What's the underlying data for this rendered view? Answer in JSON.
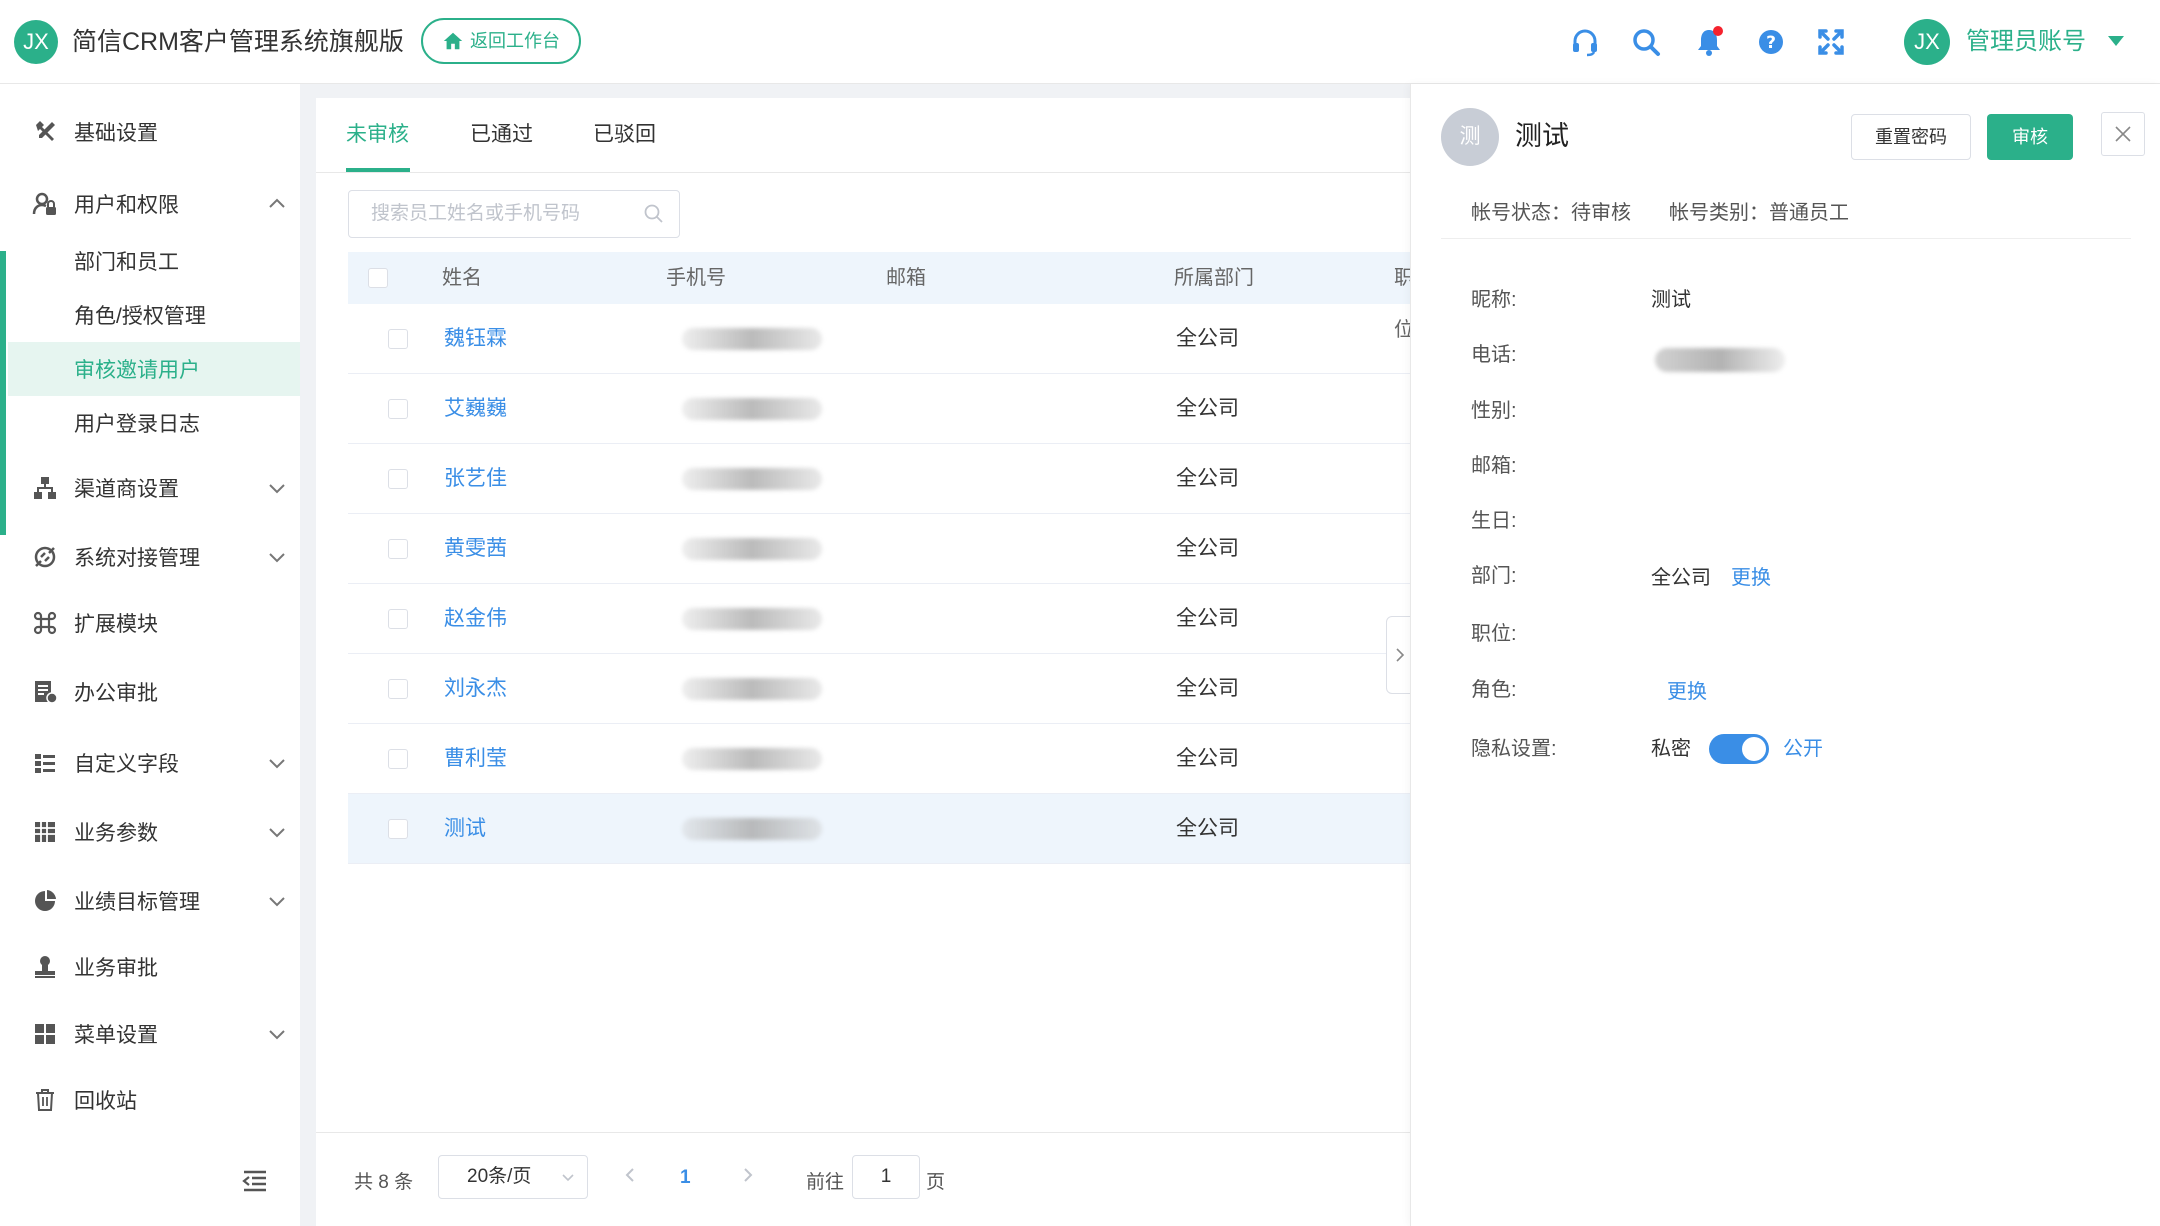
{
  "header": {
    "logo_text": "JX",
    "app_title": "简信CRM客户管理系统旗舰版",
    "back_button": "返回工作台",
    "avatar_text": "JX",
    "admin_name": "管理员账号",
    "accent_color": "#2bb08a"
  },
  "sidebar": {
    "items": [
      {
        "label": "基础设置",
        "icon": "wrench-icon"
      },
      {
        "label": "用户和权限",
        "icon": "user-lock-icon"
      },
      {
        "label": "部门和员工"
      },
      {
        "label": "角色/授权管理"
      },
      {
        "label": "审核邀请用户"
      },
      {
        "label": "用户登录日志"
      },
      {
        "label": "渠道商设置",
        "icon": "network-icon"
      },
      {
        "label": "系统对接管理",
        "icon": "plug-icon"
      },
      {
        "label": "扩展模块",
        "icon": "command-icon"
      },
      {
        "label": "办公审批",
        "icon": "approval-doc-icon"
      },
      {
        "label": "自定义字段",
        "icon": "list-icon"
      },
      {
        "label": "业务参数",
        "icon": "grid-icon"
      },
      {
        "label": "业绩目标管理",
        "icon": "target-icon"
      },
      {
        "label": "业务审批",
        "icon": "stamp-icon"
      },
      {
        "label": "菜单设置",
        "icon": "menu-grid-icon"
      },
      {
        "label": "回收站",
        "icon": "trash-icon"
      }
    ]
  },
  "main": {
    "tabs": [
      "未审核",
      "已通过",
      "已驳回"
    ],
    "search_placeholder": "搜索员工姓名或手机号码",
    "columns": [
      "姓名",
      "手机号",
      "邮箱",
      "所属部门",
      "职位"
    ],
    "rows": [
      {
        "name": "魏钰霖",
        "dept": "全公司"
      },
      {
        "name": "艾巍巍",
        "dept": "全公司"
      },
      {
        "name": "张艺佳",
        "dept": "全公司"
      },
      {
        "name": "黄雯茜",
        "dept": "全公司"
      },
      {
        "name": "赵金伟",
        "dept": "全公司"
      },
      {
        "name": "刘永杰",
        "dept": "全公司"
      },
      {
        "name": "曹利莹",
        "dept": "全公司"
      },
      {
        "name": "测试",
        "dept": "全公司"
      }
    ],
    "pager": {
      "total": "共 8 条",
      "page_size": "20条/页",
      "current_page": "1",
      "goto_label": "前往",
      "goto_value": "1",
      "page_suffix": "页"
    }
  },
  "detail": {
    "avatar_text": "测",
    "name": "测试",
    "reset_button": "重置密码",
    "approve_button": "审核",
    "status": "帐号状态：待审核",
    "type": "帐号类别：普通员工",
    "fields": {
      "nickname_label": "昵称:",
      "nickname_value": "测试",
      "phone_label": "电话:",
      "gender_label": "性别:",
      "email_label": "邮箱:",
      "birthday_label": "生日:",
      "dept_label": "部门:",
      "dept_value": "全公司",
      "dept_change": "更换",
      "position_label": "职位:",
      "role_label": "角色:",
      "role_change": "更换",
      "privacy_label": "隐私设置:",
      "privacy_off": "私密",
      "privacy_on": "公开"
    }
  }
}
